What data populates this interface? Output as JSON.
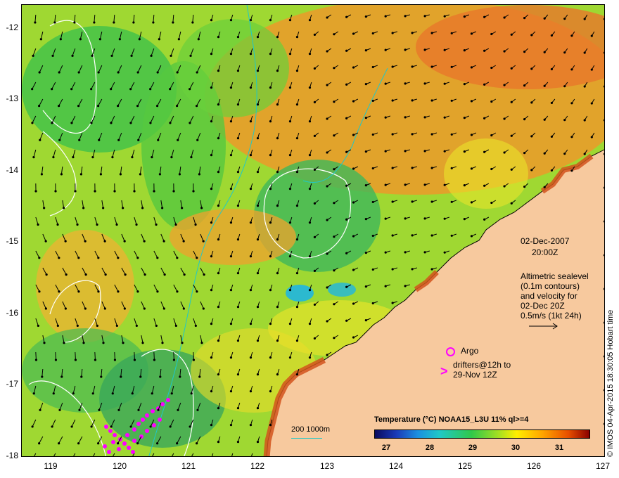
{
  "map": {
    "lat_ticks": [
      "-12",
      "-13",
      "-14",
      "-15",
      "-16",
      "-17",
      "-18"
    ],
    "lon_ticks": [
      "119",
      "120",
      "121",
      "122",
      "123",
      "124",
      "125",
      "126",
      "127"
    ],
    "lat_range": [
      -18,
      -12
    ],
    "lon_range": [
      118.6,
      127
    ],
    "colors": {
      "land": "#f7c99e",
      "contour": "#ffffff",
      "bathymetry": "#20c8c8",
      "drifter": "#ff00ff",
      "argo": "#ff00ff",
      "arrow": "#000000"
    }
  },
  "annotations": {
    "date": "02-Dec-2007",
    "time": "20:00Z",
    "altimetry_text": "Altimetric sealevel\n(0.1m contours)\nand velocity for\n02-Dec 20Z\n0.5m/s (1kt 24h)",
    "argo_label": "Argo",
    "drifter_label": "drifters@12h to\n29-Nov 12Z",
    "scale_label": "200  1000m",
    "credit": "© IMOS 04-Apr-2015 18:30:05 Hobart time"
  },
  "colorbar": {
    "title": "Temperature (°C) NOAA15_L3U 11% ql>=4",
    "ticks": [
      "27",
      "28",
      "29",
      "30",
      "31"
    ],
    "range": [
      26.6,
      31.6
    ]
  }
}
